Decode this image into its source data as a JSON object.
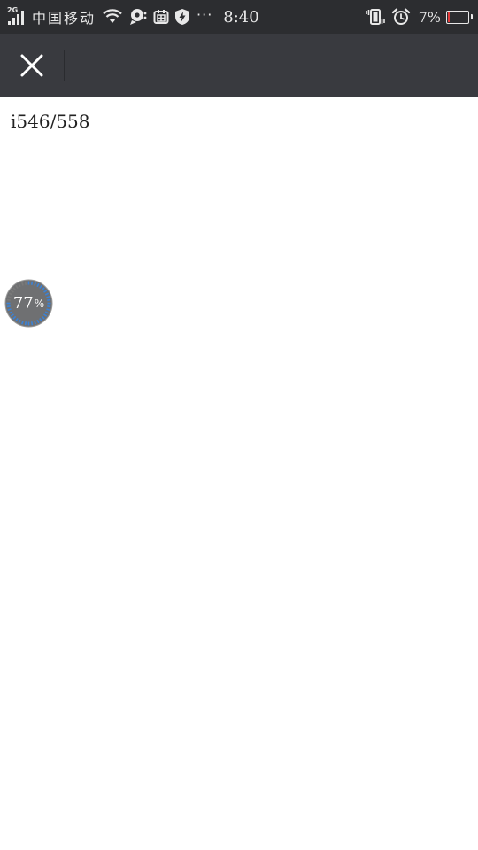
{
  "status_bar": {
    "network_type": "2G",
    "carrier": "中国移动",
    "overflow_dots": "···",
    "time": "8:40",
    "battery_level": "7%",
    "battery_fraction": 0.07,
    "battery_color": "#e23a3a",
    "icons": [
      "signal-icon",
      "wifi-icon",
      "map-pin-icon",
      "calendar-icon",
      "shield-bolt-icon",
      "vibrate-icon",
      "alarm-icon",
      "battery-icon"
    ]
  },
  "toolbar": {
    "background": "#393a3f",
    "icons": [
      "close-icon"
    ]
  },
  "content": {
    "page_counter": "i546/558"
  },
  "progress": {
    "value": 77,
    "label_number": "77",
    "label_unit": "%",
    "accent_color": "#3b82d6",
    "track_color": "#7a7a7a"
  }
}
